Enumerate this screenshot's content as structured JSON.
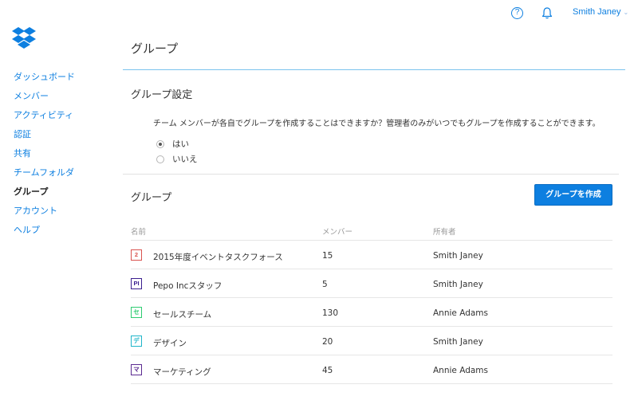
{
  "header": {
    "help_icon": "help-circle-icon",
    "help_glyph": "?",
    "bell_icon": "bell-icon",
    "user_name": "Smith Janey",
    "user_chevron": "⌄"
  },
  "colors": {
    "accent": "#0d7fe0",
    "title_rule": "#7bc3ee",
    "text": "#333333",
    "muted": "#999999"
  },
  "sidebar": {
    "logo_icon": "dropbox-logo-icon",
    "items": [
      {
        "label": "ダッシュボード",
        "active": false
      },
      {
        "label": "メンバー",
        "active": false
      },
      {
        "label": "アクティビティ",
        "active": false
      },
      {
        "label": "認証",
        "active": false
      },
      {
        "label": "共有",
        "active": false
      },
      {
        "label": "チームフォルダ",
        "active": false
      },
      {
        "label": "グループ",
        "active": true
      },
      {
        "label": "アカウント",
        "active": false
      },
      {
        "label": "ヘルプ",
        "active": false
      }
    ]
  },
  "main": {
    "title": "グループ",
    "settings": {
      "title": "グループ設定",
      "question": "チーム メンバーが各自でグループを作成することはできますか？管理者のみがいつでもグループを作成することができます。",
      "options": [
        {
          "label": "はい",
          "checked": true
        },
        {
          "label": "いいえ",
          "checked": false
        }
      ]
    },
    "groups": {
      "title": "グループ",
      "create_button": "グループを作成",
      "columns": {
        "name": "名前",
        "members": "メンバー",
        "owner": "所有者"
      },
      "rows": [
        {
          "badge": "2",
          "badge_color": "#d9534f",
          "name": "2015年度イベントタスクフォース",
          "members": "15",
          "owner": "Smith Janey"
        },
        {
          "badge": "PI",
          "badge_color": "#3b1f8f",
          "name": "Pepo Incスタッフ",
          "members": "5",
          "owner": "Smith Janey"
        },
        {
          "badge": "セ",
          "badge_color": "#2ecc71",
          "name": "セールスチーム",
          "members": "130",
          "owner": "Annie Adams"
        },
        {
          "badge": "デ",
          "badge_color": "#1fb5c9",
          "name": "デザイン",
          "members": "20",
          "owner": "Smith Janey"
        },
        {
          "badge": "マ",
          "badge_color": "#5b2a91",
          "name": "マーケティング",
          "members": "45",
          "owner": "Annie Adams"
        }
      ]
    }
  }
}
